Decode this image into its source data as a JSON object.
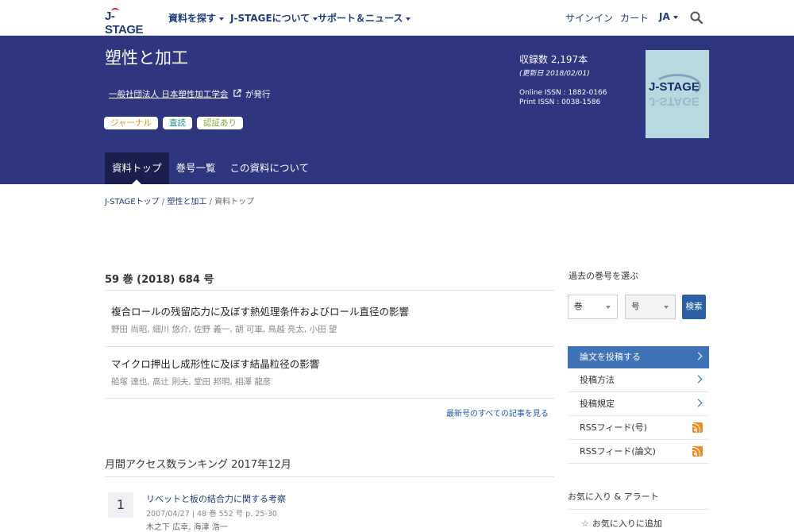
{
  "nav": {
    "logo": "J-STAGE",
    "items": [
      "資料を探す",
      "J-STAGEについて",
      "サポート＆ニュース"
    ],
    "signin": "サインイン",
    "cart": "カート",
    "lang": "JA"
  },
  "journal": {
    "title": "塑性と加工",
    "publisher": "一般社団法人 日本塑性加工学会",
    "publisher_suffix": "が発行",
    "tags": [
      "ジャーナル",
      "査読",
      "認証あり"
    ],
    "count": "収録数 2,197本",
    "updated": "(更新日 2018/02/01)",
    "online_issn": "Online ISSN : 1882-0166",
    "print_issn": "Print ISSN : 0038-1586",
    "cover_logo": "J-STAGE"
  },
  "tabs": [
    "資料トップ",
    "巻号一覧",
    "この資料について"
  ],
  "breadcrumb": {
    "home": "J-STAGEトップ",
    "journal": "塑性と加工",
    "current": "資料トップ",
    "sep": "/"
  },
  "issue": {
    "title": "59 巻 (2018) 684 号",
    "articles": [
      {
        "title": "複合ロールの残留応力に及ぼす熱処理条件およびロール直径の影響",
        "authors": "野田 尚昭, 細川 悠介, 佐野 義一, 胡 可軍, 鳥越 亮太, 小田 望"
      },
      {
        "title": "マイクロ押出し成形性に及ぼす結晶粒径の影響",
        "authors": "船塚 達也, 高辻 則夫, 堂田 邦明, 相澤 龍彦"
      }
    ],
    "more": "最新号のすべての記事を見る"
  },
  "ranking": {
    "title": "月間アクセス数ランキング 2017年12月",
    "items": [
      {
        "rank": "1",
        "title": "リベットと板の結合力に関する考察",
        "meta": "2007/04/27 | 48 巻 552 号 p. 25-30",
        "authors": "木之下 広幸, 海津 浩一"
      }
    ]
  },
  "sidebar": {
    "pick_label": "過去の巻号を選ぶ",
    "volume": "巻",
    "number": "号",
    "search": "検索",
    "links": [
      "論文を投稿する",
      "投稿方法",
      "投稿規定",
      "RSSフィード(号)",
      "RSSフィード(論文)"
    ],
    "fav_title": "お気に入り & アラート",
    "fav_add": "お気に入りに追加"
  },
  "colors": {
    "band": "#2d367e",
    "active_tab": "#1b1f4e",
    "primary": "#3f72b6",
    "rss": "#f08a24"
  }
}
